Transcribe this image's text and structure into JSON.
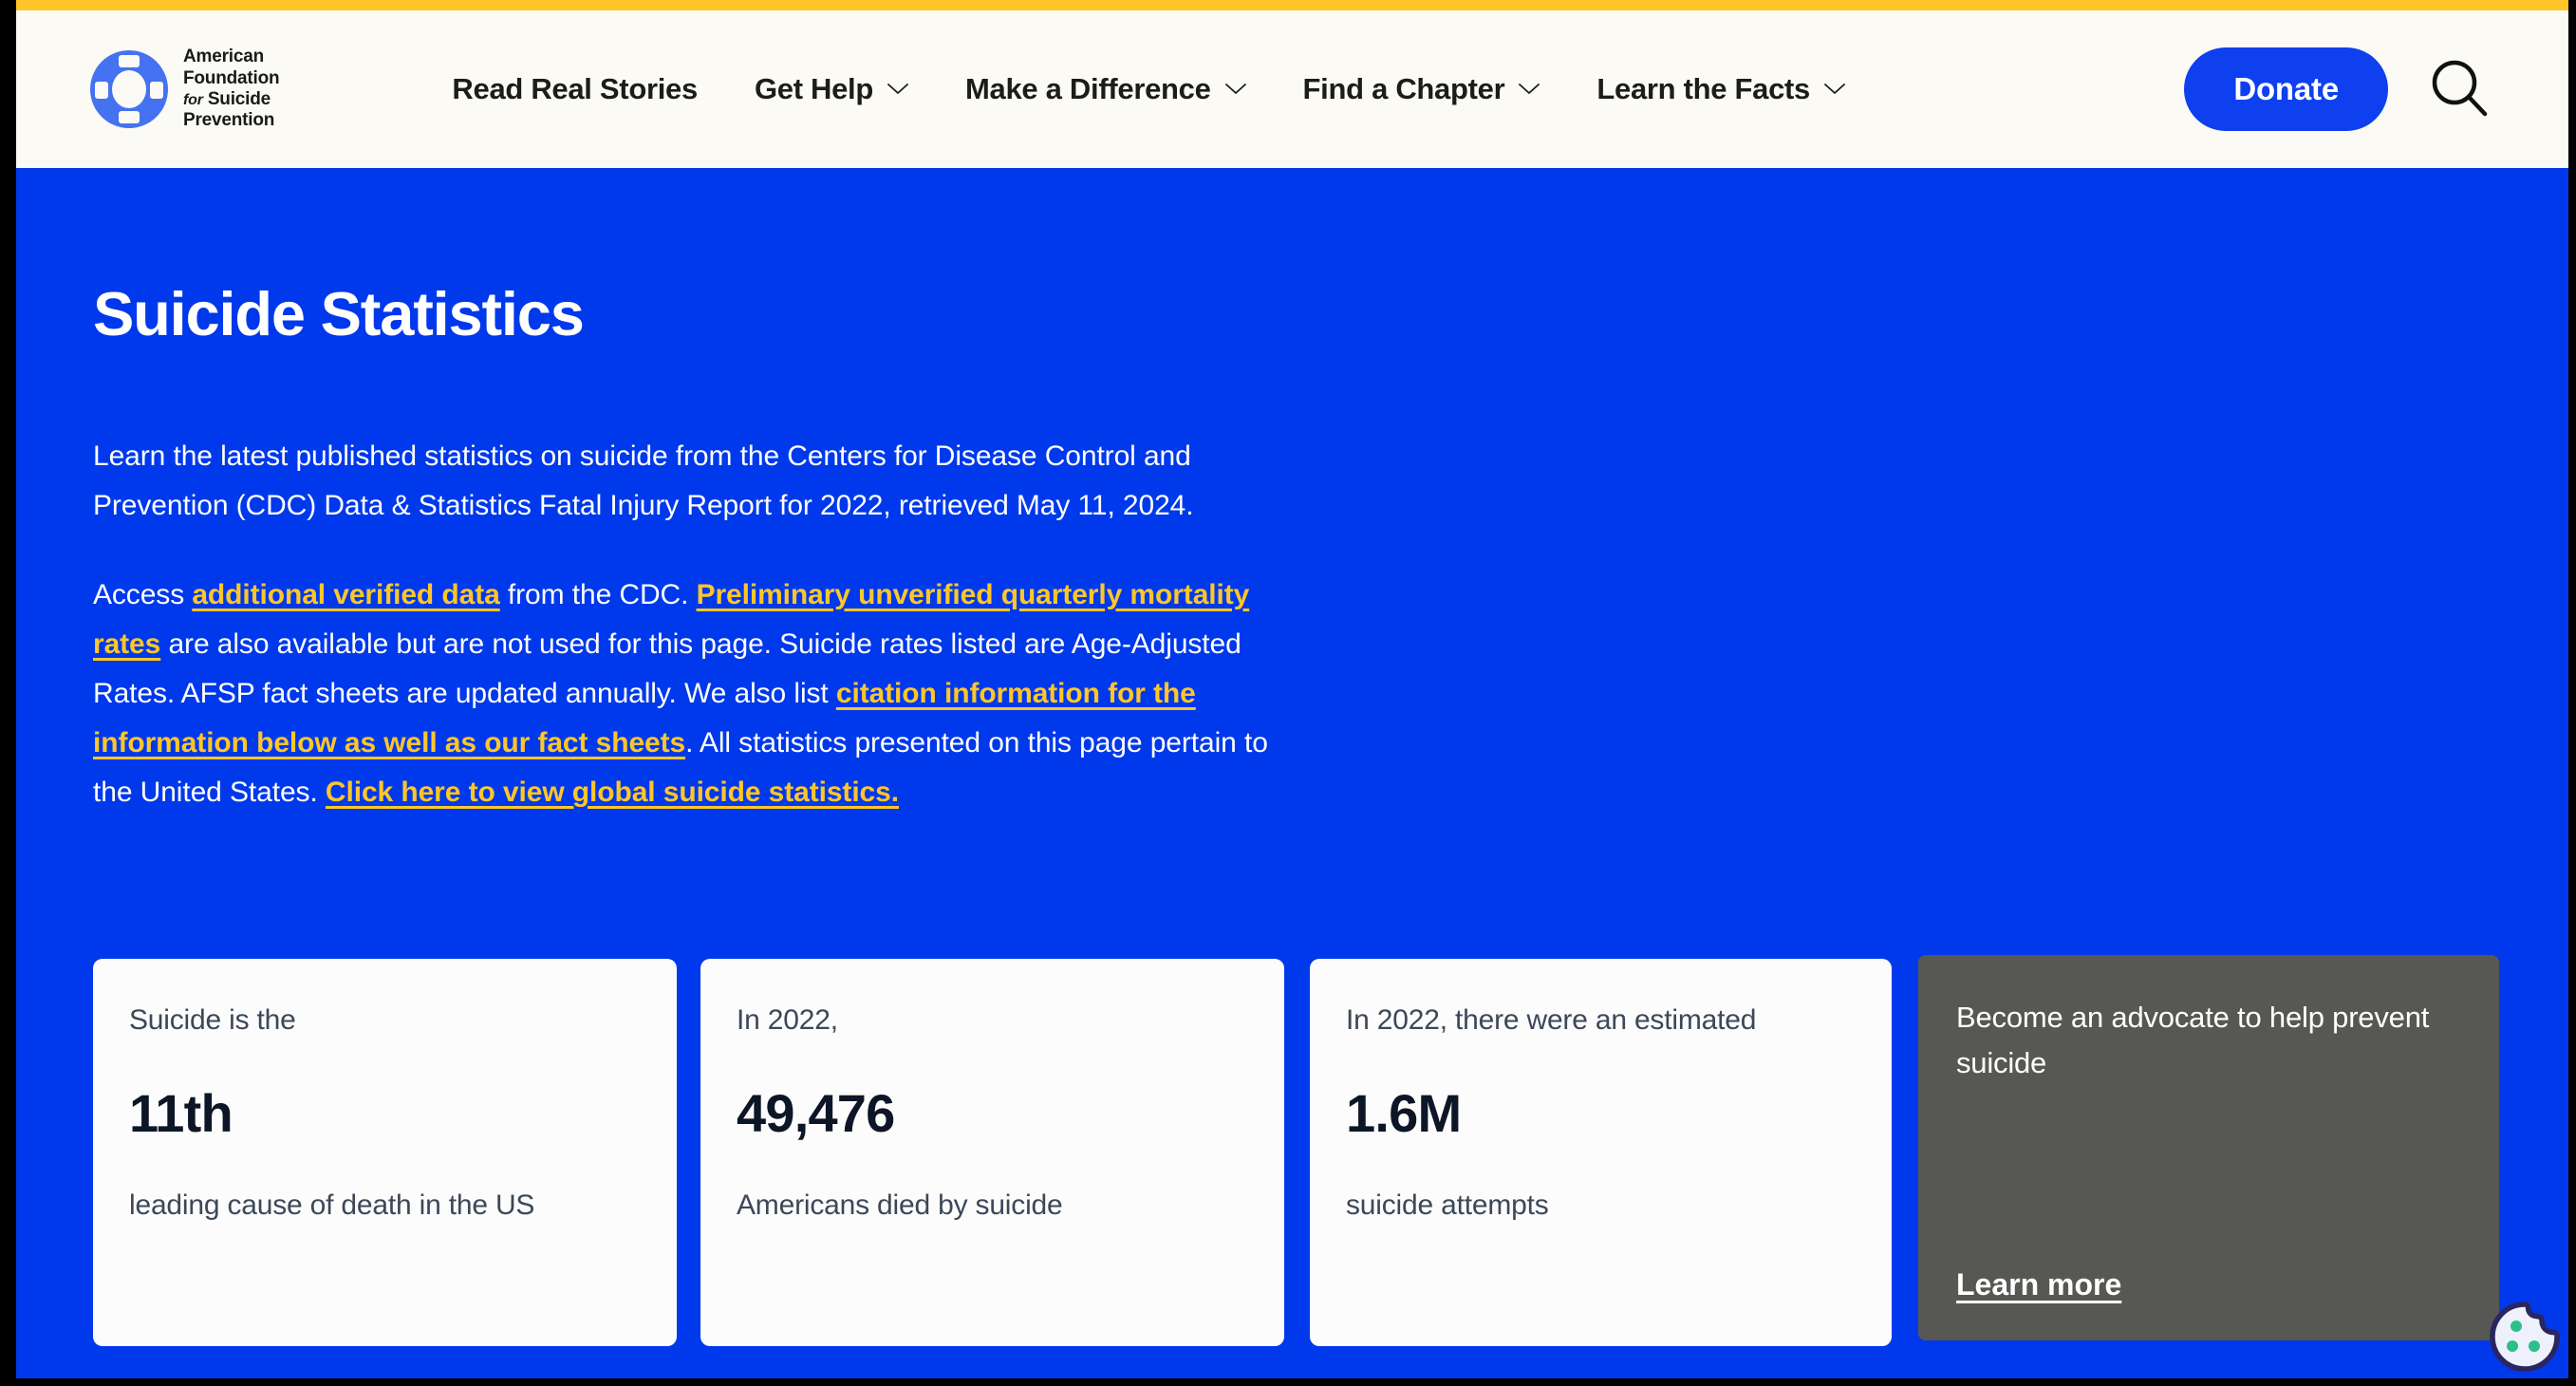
{
  "brand": {
    "logo_line1": "American",
    "logo_line2": "Foundation",
    "logo_for": "for",
    "logo_line3": "Suicide",
    "logo_line4": "Prevention",
    "logo_icon": "life-ring-icon",
    "accent_yellow": "#FFC629",
    "brand_blue": "#0039EB",
    "header_cream": "#FBFAF5"
  },
  "header": {
    "nav_items": [
      {
        "label": "Read Real Stories",
        "has_dropdown": false
      },
      {
        "label": "Get Help",
        "has_dropdown": true
      },
      {
        "label": "Make a Difference",
        "has_dropdown": true
      },
      {
        "label": "Find a Chapter",
        "has_dropdown": true
      },
      {
        "label": "Learn the Facts",
        "has_dropdown": true
      }
    ],
    "donate_label": "Donate",
    "search_icon": "search-icon"
  },
  "hero": {
    "title": "Suicide Statistics",
    "paragraph1": "Learn the latest published statistics on suicide from the Centers for Disease Control and Prevention (CDC) Data & Statistics Fatal Injury Report for 2022, retrieved May 11, 2024.",
    "paragraph2": {
      "seg1": "Access ",
      "link1": "additional verified data",
      "seg2": " from the CDC. ",
      "link2": "Preliminary unverified quarterly mortality rates",
      "seg3": " are also available but are not used for this page. Suicide rates listed are Age-Adjusted Rates. AFSP fact sheets are updated annually. We also list ",
      "link3": "citation information for the information below as well as our fact sheets",
      "seg4": ". All statistics presented on this page pertain to the United States. ",
      "link4": "Click here to view global suicide statistics."
    }
  },
  "stat_cards": [
    {
      "pre": "Suicide is the",
      "figure": "11th",
      "post": "leading cause of death in the US"
    },
    {
      "pre": "In 2022,",
      "figure": "49,476",
      "post": "Americans died by suicide"
    },
    {
      "pre": "In 2022, there were an estimated",
      "figure": "1.6M",
      "post": "suicide attempts"
    }
  ],
  "advocate_card": {
    "title": "Become an advocate to help prevent suicide",
    "link_label": "Learn more",
    "background": "#575754"
  },
  "cookie_widget": {
    "icon": "cookie-icon"
  }
}
